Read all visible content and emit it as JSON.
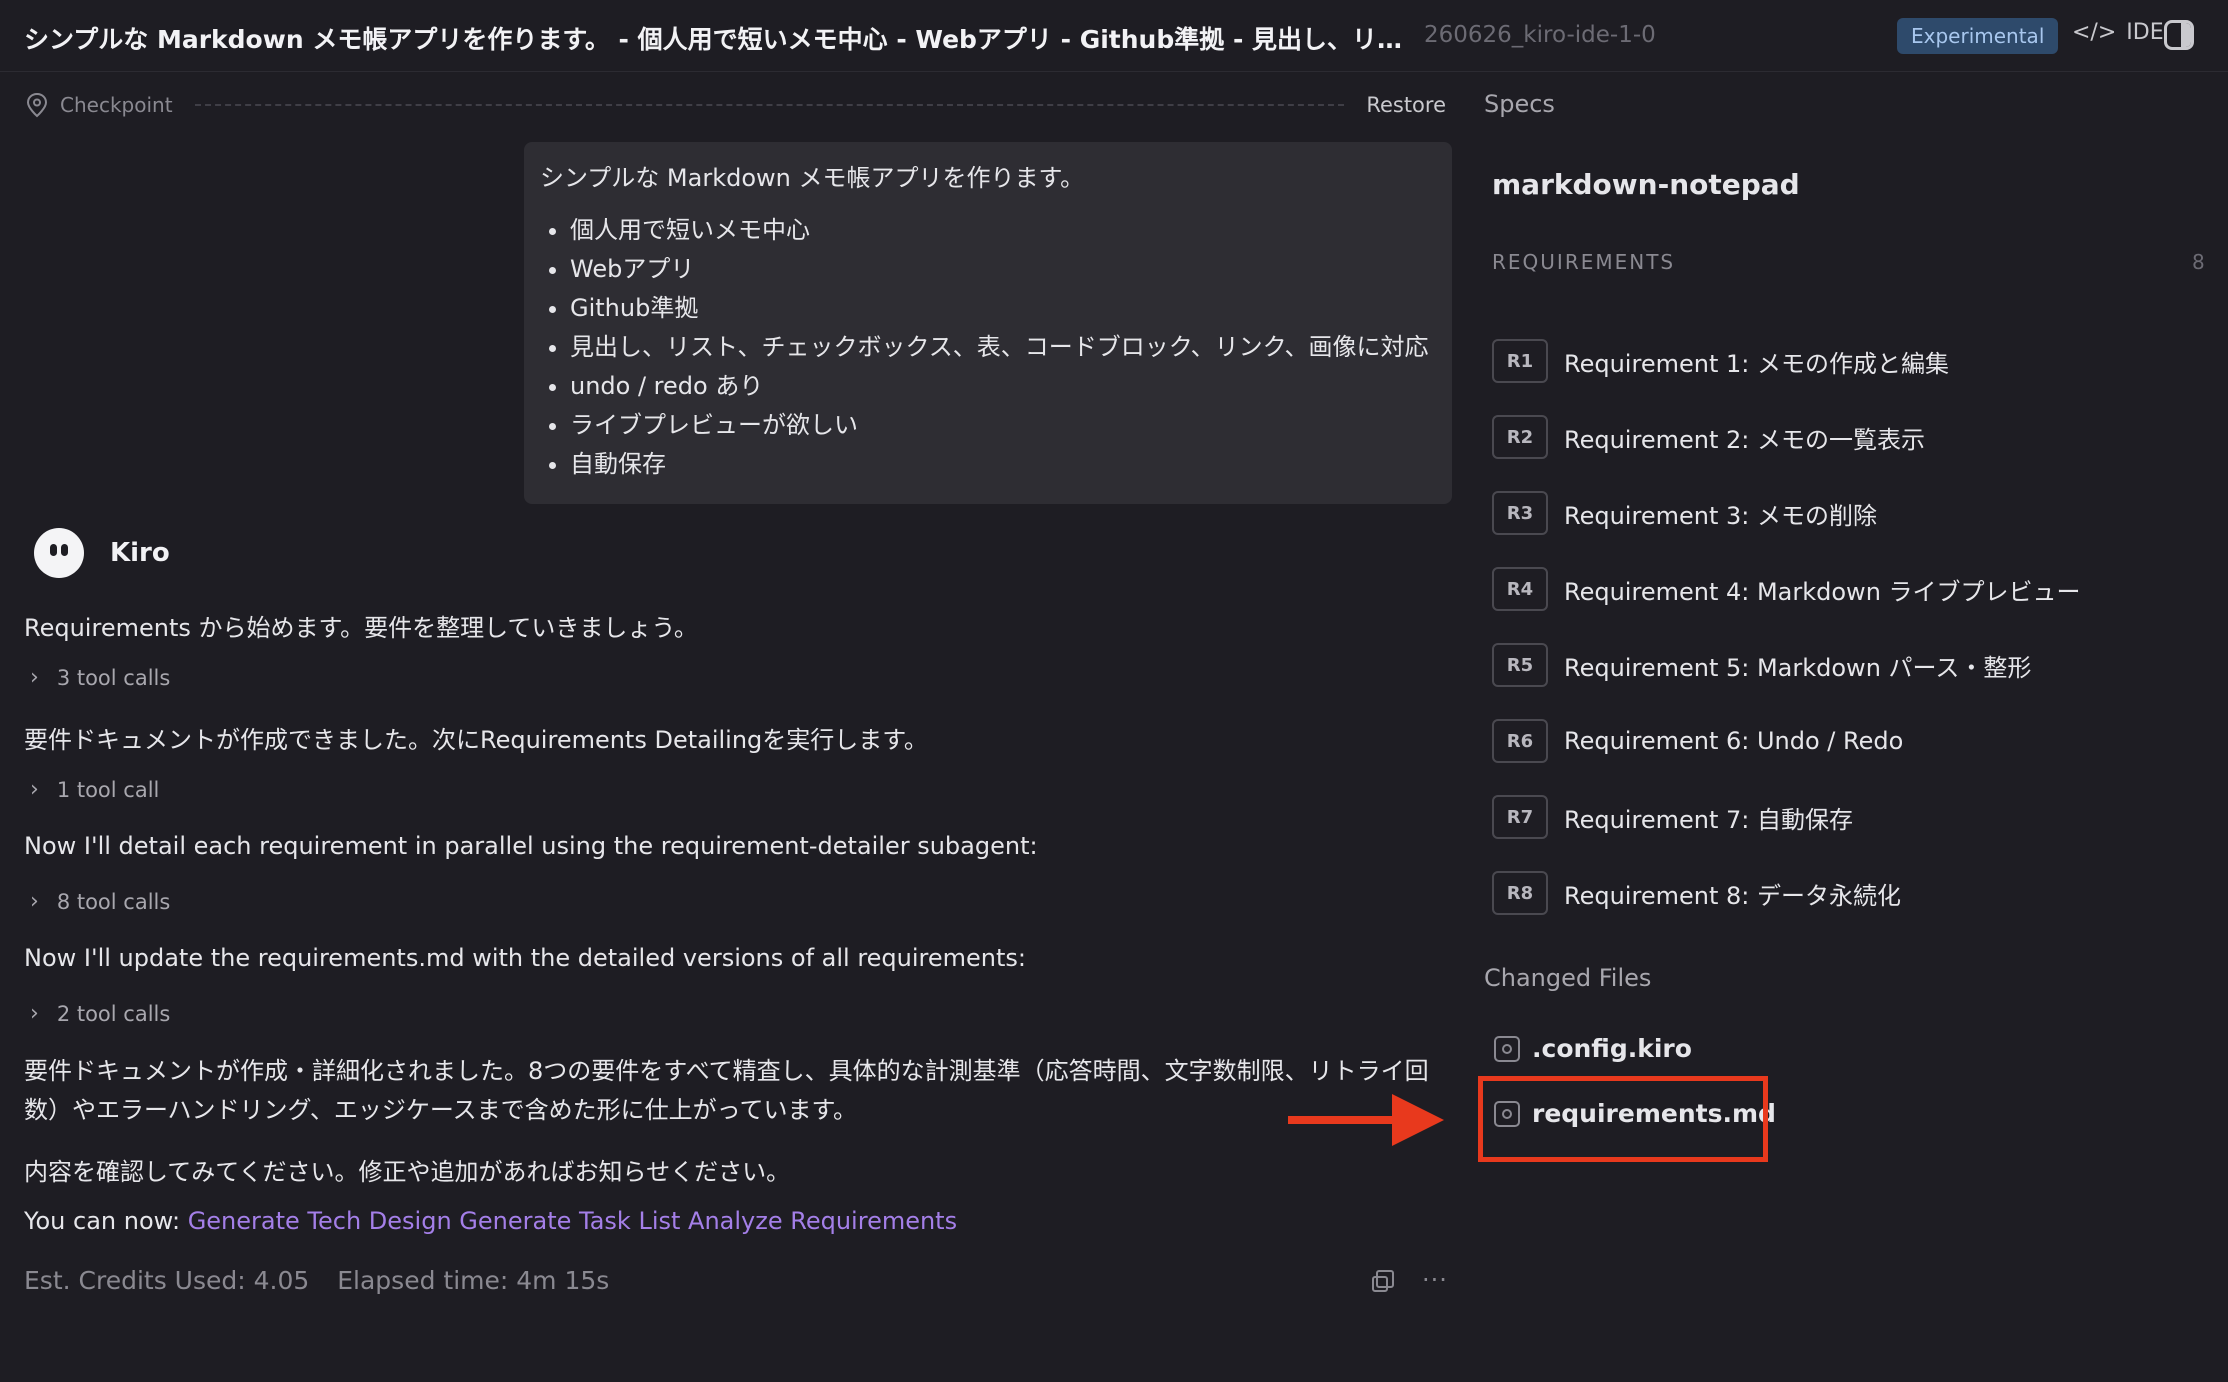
{
  "header": {
    "title": "シンプルな Markdown メモ帳アプリを作ります。 - 個人用で短いメモ中心 - Webアプリ - Github準拠 - 見出し、リスト、チェックボ...",
    "session": "260626_kiro-ide-1-0",
    "badge": "Experimental",
    "ide_label": "IDE"
  },
  "checkpoint": {
    "label": "Checkpoint",
    "restore": "Restore"
  },
  "user_message": {
    "intro": "シンプルな Markdown メモ帳アプリを作ります。",
    "bullets": [
      "個人用で短いメモ中心",
      "Webアプリ",
      "Github準拠",
      "見出し、リスト、チェックボックス、表、コードブロック、リンク、画像に対応",
      "undo / redo あり",
      "ライブプレビューが欲しい",
      "自動保存"
    ]
  },
  "assistant": {
    "name": "Kiro",
    "messages": [
      "Requirements から始めます。要件を整理していきましょう。",
      "要件ドキュメントが作成できました。次にRequirements Detailingを実行します。",
      "Now I'll detail each requirement in parallel using the requirement-detailer subagent:",
      "Now I'll update the requirements.md with the detailed versions of all requirements:",
      "要件ドキュメントが作成・詳細化されました。8つの要件をすべて精査し、具体的な計測基準（応答時間、文字数制限、リトライ回数）やエラーハンドリング、エッジケースまで含めた形に仕上がっています。",
      "内容を確認してみてください。修正や追加があればお知らせください。"
    ],
    "tool_calls": [
      "3 tool calls",
      "1 tool call",
      "8 tool calls",
      "2 tool calls"
    ],
    "next_prefix": "You can now:",
    "next_links": [
      "Generate Tech Design",
      "Generate Task List",
      "Analyze Requirements"
    ],
    "credits": "Est. Credits Used: 4.05",
    "elapsed": "Elapsed time: 4m 15s"
  },
  "specs": {
    "label": "Specs",
    "name": "markdown-notepad",
    "requirements_header": "REQUIREMENTS",
    "requirements_count": "8",
    "requirements": [
      {
        "tag": "R1",
        "label": "Requirement 1: メモの作成と編集"
      },
      {
        "tag": "R2",
        "label": "Requirement 2: メモの一覧表示"
      },
      {
        "tag": "R3",
        "label": "Requirement 3: メモの削除"
      },
      {
        "tag": "R4",
        "label": "Requirement 4: Markdown ライブプレビュー"
      },
      {
        "tag": "R5",
        "label": "Requirement 5: Markdown パース・整形"
      },
      {
        "tag": "R6",
        "label": "Requirement 6: Undo / Redo"
      },
      {
        "tag": "R7",
        "label": "Requirement 7: 自動保存"
      },
      {
        "tag": "R8",
        "label": "Requirement 8: データ永続化"
      }
    ],
    "changed_files_label": "Changed Files",
    "changed_files": [
      ".config.kiro",
      "requirements.md"
    ]
  },
  "colors": {
    "accent_link": "#a47fe8",
    "highlight": "#e8391d",
    "badge_bg": "#2e4a6b"
  }
}
